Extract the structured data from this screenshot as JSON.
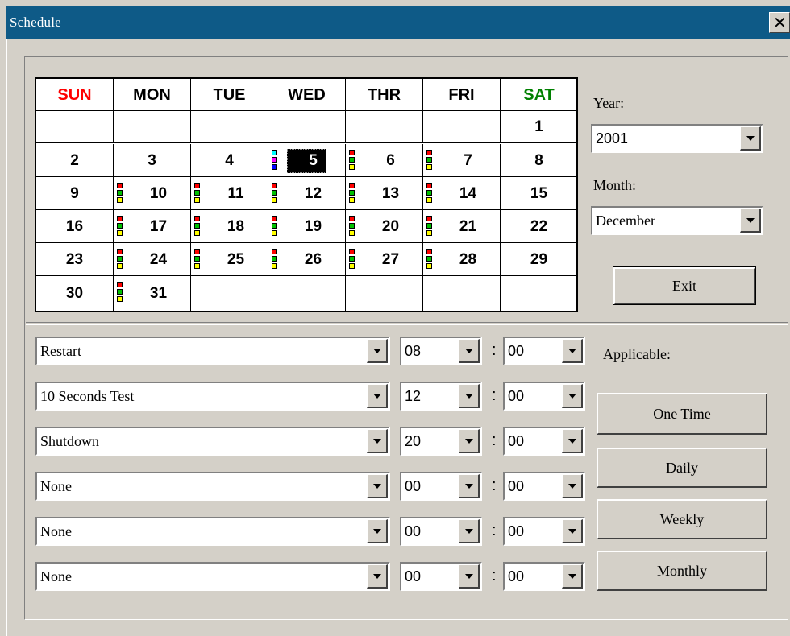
{
  "window": {
    "title": "Schedule",
    "close_glyph": "✕"
  },
  "calendar": {
    "headers": [
      {
        "label": "SUN",
        "color": "#ff0000"
      },
      {
        "label": "MON",
        "color": "#000000"
      },
      {
        "label": "TUE",
        "color": "#000000"
      },
      {
        "label": "WED",
        "color": "#000000"
      },
      {
        "label": "THR",
        "color": "#000000"
      },
      {
        "label": "FRI",
        "color": "#000000"
      },
      {
        "label": "SAT",
        "color": "#008000"
      }
    ],
    "weeks": [
      [
        "",
        "",
        "",
        "",
        "",
        "",
        "1"
      ],
      [
        "2",
        "3",
        "4",
        "5",
        "6",
        "7",
        "8"
      ],
      [
        "9",
        "10",
        "11",
        "12",
        "13",
        "14",
        "15"
      ],
      [
        "16",
        "17",
        "18",
        "19",
        "20",
        "21",
        "22"
      ],
      [
        "23",
        "24",
        "25",
        "26",
        "27",
        "28",
        "29"
      ],
      [
        "30",
        "31",
        "",
        "",
        "",
        "",
        ""
      ]
    ],
    "selected_day": "5",
    "event_days": [
      "5",
      "6",
      "7",
      "10",
      "11",
      "12",
      "13",
      "14",
      "17",
      "18",
      "19",
      "20",
      "21",
      "24",
      "25",
      "26",
      "27",
      "28",
      "31"
    ],
    "event_colors": [
      "#ff0000",
      "#00c000",
      "#ffff00"
    ],
    "selected_event_colors": [
      "#00ffff",
      "#ff00ff",
      "#0000ff"
    ]
  },
  "year": {
    "label": "Year:",
    "value": "2001"
  },
  "month": {
    "label": "Month:",
    "value": "December"
  },
  "exit_button": "Exit",
  "schedule_rows": [
    {
      "action": "Restart",
      "hour": "08",
      "minute": "00"
    },
    {
      "action": "10 Seconds Test",
      "hour": "12",
      "minute": "00"
    },
    {
      "action": "Shutdown",
      "hour": "20",
      "minute": "00"
    },
    {
      "action": "None",
      "hour": "00",
      "minute": "00"
    },
    {
      "action": "None",
      "hour": "00",
      "minute": "00"
    },
    {
      "action": "None",
      "hour": "00",
      "minute": "00"
    }
  ],
  "time_separator": ":",
  "applicable": {
    "label": "Applicable:",
    "buttons": [
      "One Time",
      "Daily",
      "Weekly",
      "Monthly"
    ]
  }
}
